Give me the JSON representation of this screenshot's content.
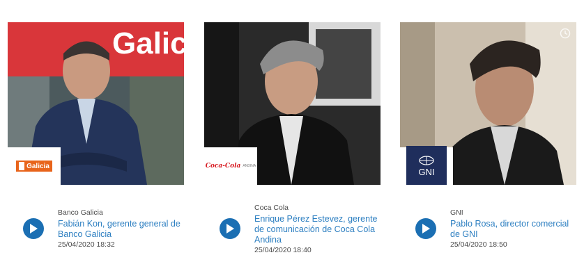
{
  "cards": [
    {
      "company": "Banco Galicia",
      "title": "Fabián Kon, gerente general de Banco Galicia",
      "date": "25/04/2020 18:32",
      "logo_text": "Galicia",
      "sign_text": "Galic"
    },
    {
      "company": "Coca Cola",
      "title": "Enrique Pérez Estevez, gerente de comunicación de Coca Cola Andina",
      "date": "25/04/2020 18:40",
      "logo_text": "Coca-Cola",
      "logo_sub": "ANDINA"
    },
    {
      "company": "GNI",
      "title": "Pablo Rosa, director comercial de GNI",
      "date": "25/04/2020 18:50",
      "logo_text": "GNI"
    }
  ],
  "colors": {
    "link": "#2d7fc1",
    "play": "#1b6fb3",
    "galicia_orange": "#e8641b",
    "gni_navy": "#1f2e5c",
    "coca_red": "#d71920"
  },
  "icons": [
    "play-icon",
    "clock-icon"
  ]
}
